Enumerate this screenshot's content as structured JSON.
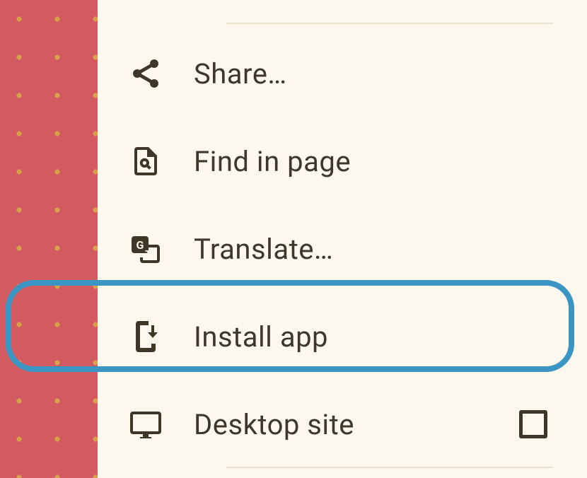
{
  "menu": {
    "share": {
      "label": "Share…"
    },
    "find": {
      "label": "Find in page"
    },
    "translate": {
      "label": "Translate…"
    },
    "install": {
      "label": "Install app"
    },
    "desktop": {
      "label": "Desktop site",
      "checked": false
    }
  },
  "highlight": "install",
  "colors": {
    "panel_bg": "#fdf8ee",
    "page_bg": "#d45a62",
    "dots": "#d8a24a",
    "text": "#3d382b",
    "callout": "#3b95c3"
  }
}
